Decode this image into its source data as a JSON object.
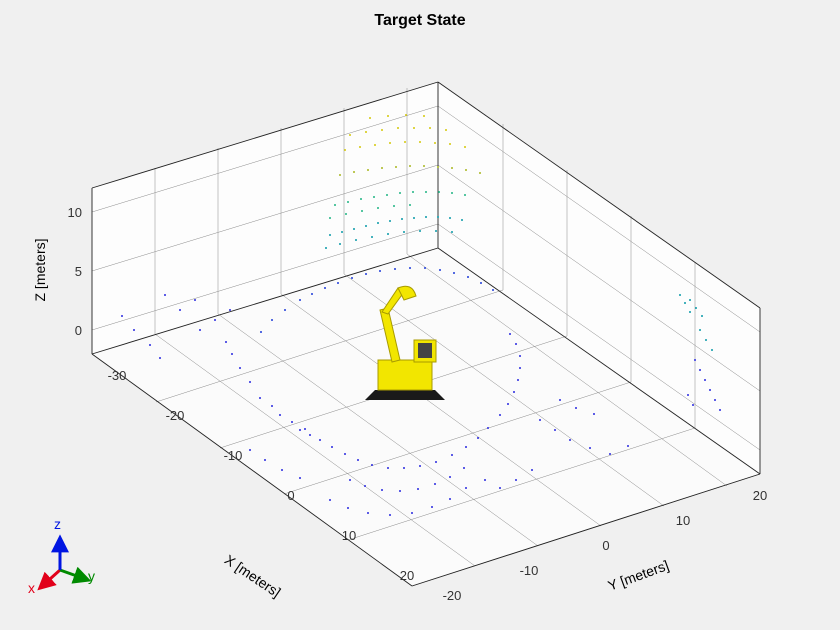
{
  "chart_data": {
    "type": "scatter",
    "title": "Target State",
    "xlabel": "X [meters]",
    "ylabel": "Y [meters]",
    "zlabel": "Z [meters]",
    "xlim": [
      -30,
      25
    ],
    "ylim": [
      -20,
      25
    ],
    "zlim": [
      -2,
      12
    ],
    "xticks": [
      -30,
      -20,
      -10,
      0,
      10,
      20
    ],
    "yticks": [
      -20,
      -10,
      0,
      10,
      20
    ],
    "zticks": [
      0,
      5,
      10
    ],
    "grid": true,
    "colormap": "parula",
    "color_by": "z",
    "series": [
      {
        "name": "point-cloud",
        "description": "LiDAR-like 3D point cloud of environment colored by height",
        "approx_point_count": 12000
      },
      {
        "name": "robot-model",
        "description": "Yellow excavator / robot mesh at origin",
        "color": "#f2e600"
      }
    ],
    "view_azimuth_deg": -37.5,
    "view_elevation_deg": 30,
    "inset_axes": {
      "x": {
        "color": "#e2001a",
        "label": "x"
      },
      "y": {
        "color": "#008a00",
        "label": "y"
      },
      "z": {
        "color": "#0015e2",
        "label": "z"
      }
    }
  }
}
